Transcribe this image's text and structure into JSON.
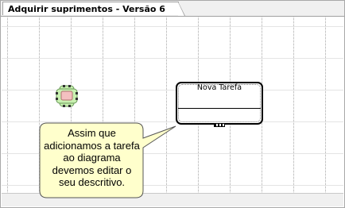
{
  "tab": {
    "title": "Adquirir suprimentos - Versão 6"
  },
  "task": {
    "title": "Nova Tarefa"
  },
  "callout": {
    "text": "Assim que adicionamos a tarefa ao diagrama devemos editar o seu descritivo."
  },
  "icons": {
    "start_node": "pool-element-icon",
    "task_handle": "connection-handle-icon"
  },
  "colors": {
    "callout_fill": "#ffffcc",
    "start_node_fill": "#c8f0b0",
    "start_node_core": "#f4c0c0",
    "grid_line": "#bebebe"
  }
}
